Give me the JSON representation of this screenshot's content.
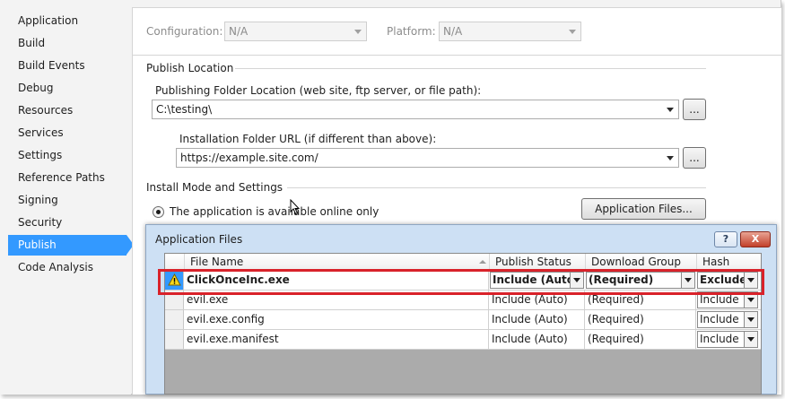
{
  "sidebar": {
    "items": [
      {
        "label": "Application"
      },
      {
        "label": "Build"
      },
      {
        "label": "Build Events"
      },
      {
        "label": "Debug"
      },
      {
        "label": "Resources"
      },
      {
        "label": "Services"
      },
      {
        "label": "Settings"
      },
      {
        "label": "Reference Paths"
      },
      {
        "label": "Signing"
      },
      {
        "label": "Security"
      },
      {
        "label": "Publish"
      },
      {
        "label": "Code Analysis"
      }
    ],
    "active": "Publish"
  },
  "toolbar": {
    "configuration_label": "Configuration:",
    "configuration_value": "N/A",
    "platform_label": "Platform:",
    "platform_value": "N/A"
  },
  "publish_location": {
    "section_title": "Publish Location",
    "folder_label": "Publishing Folder Location (web site, ftp server, or file path):",
    "folder_value": "C:\\testing\\",
    "install_url_label": "Installation Folder URL (if different than above):",
    "install_url_value": "https://example.site.com/",
    "browse_label": "..."
  },
  "install_mode": {
    "section_title": "Install Mode and Settings",
    "radio_label": "The application is available online only",
    "app_files_button": "Application Files..."
  },
  "dialog": {
    "title": "Application Files",
    "help_label": "?",
    "close_label": "X",
    "columns": [
      "File Name",
      "Publish Status",
      "Download Group",
      "Hash"
    ],
    "rows": [
      {
        "file": "ClickOnceInc.exe",
        "status": "Include (Auto)",
        "group": "(Required)",
        "hash": "Exclude",
        "warning": true
      },
      {
        "file": "evil.exe",
        "status": "Include (Auto)",
        "group": "(Required)",
        "hash": "Include",
        "warning": false
      },
      {
        "file": "evil.exe.config",
        "status": "Include (Auto)",
        "group": "(Required)",
        "hash": "Include",
        "warning": false
      },
      {
        "file": "evil.exe.manifest",
        "status": "Include (Auto)",
        "group": "(Required)",
        "hash": "Include",
        "warning": false
      }
    ]
  },
  "colors": {
    "accent": "#3399ff",
    "highlight_border": "#d9222a",
    "dialog_bg": "#cde0f4"
  }
}
